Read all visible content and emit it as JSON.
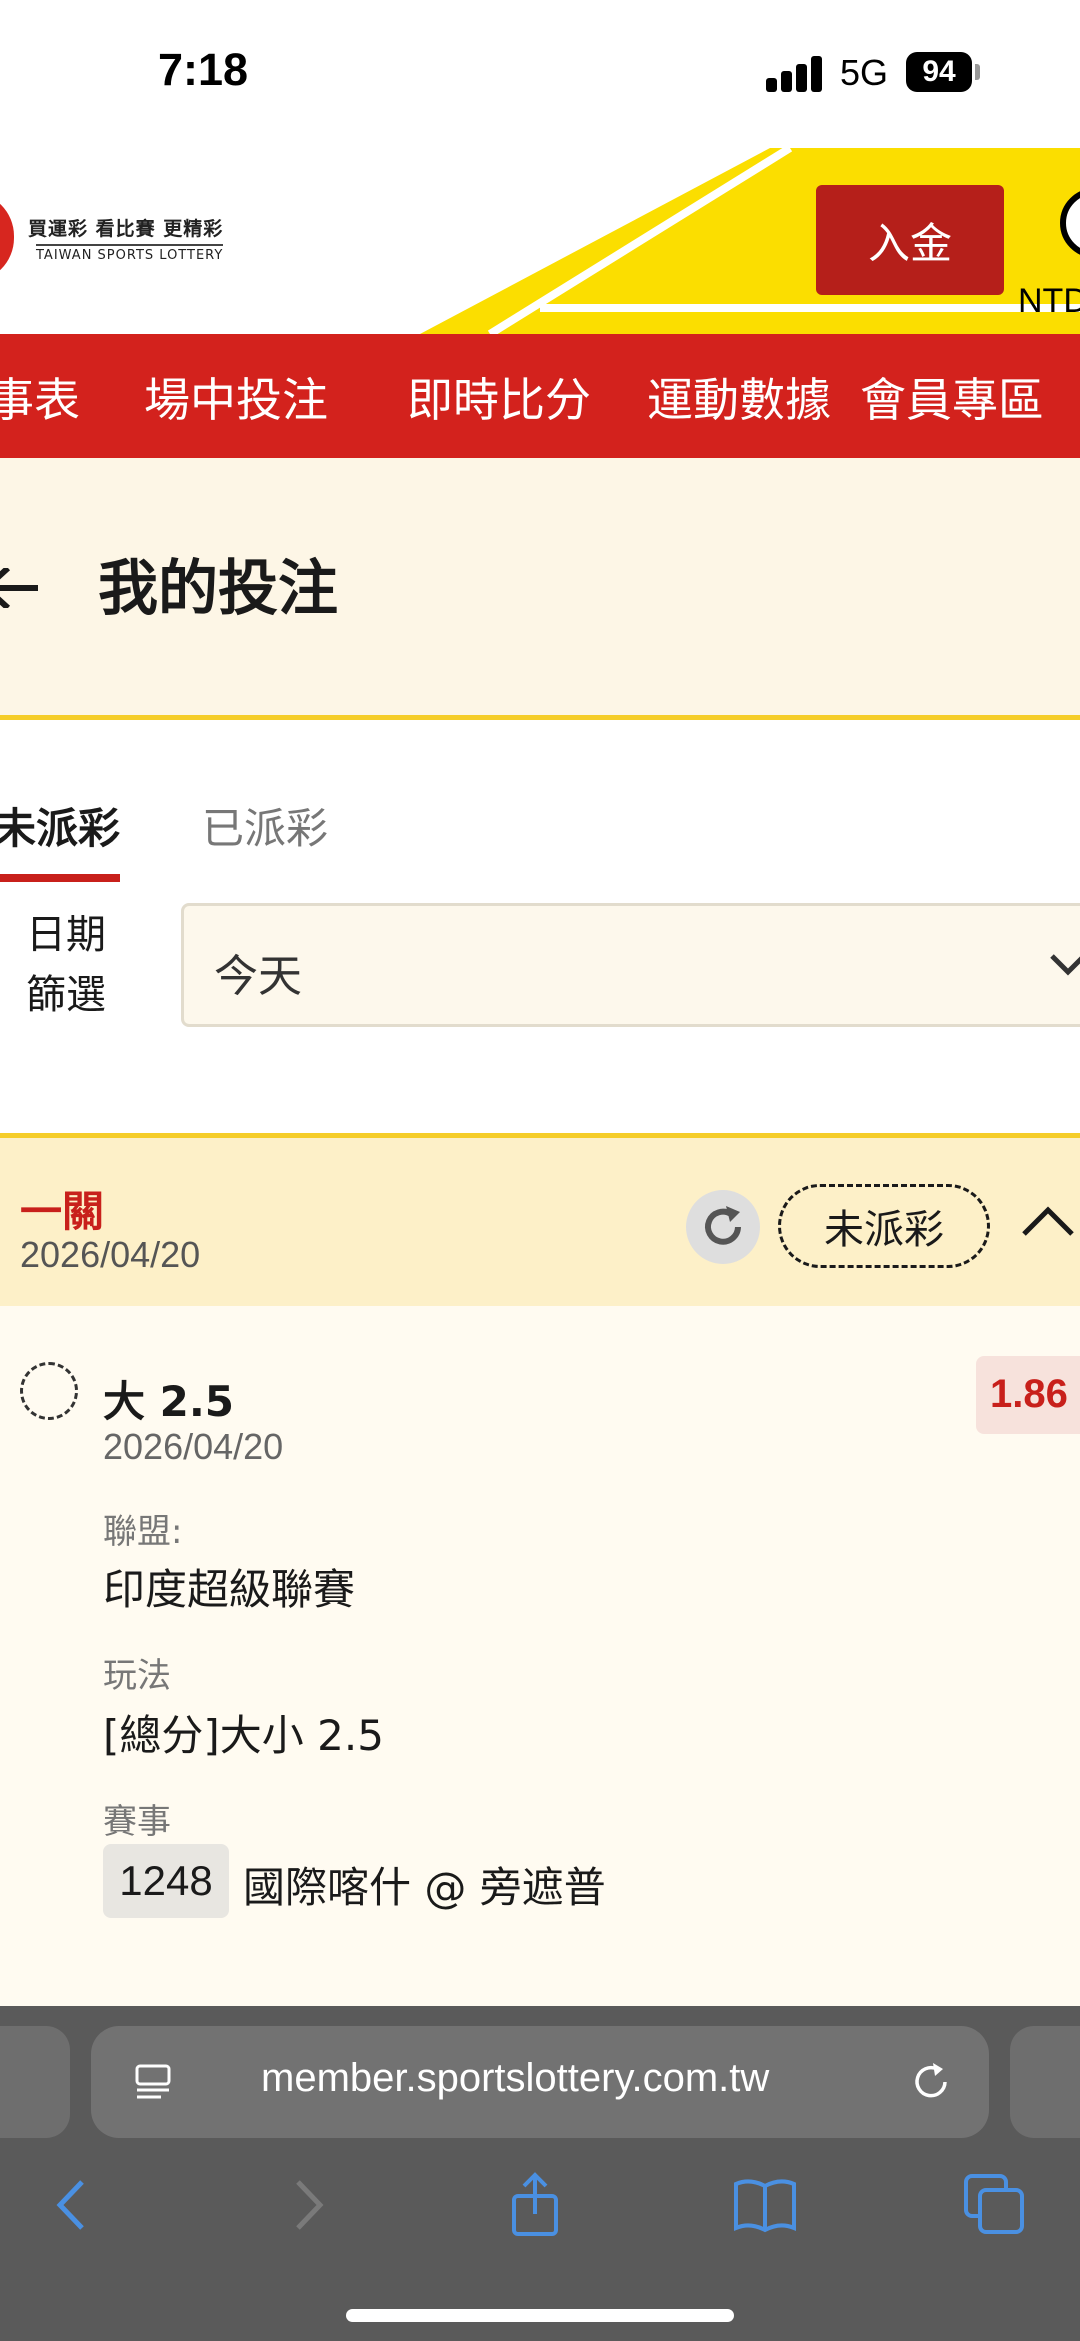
{
  "status_bar": {
    "time": "7:18",
    "network": "5G",
    "battery": "94"
  },
  "header": {
    "logo_line1": "買運彩 看比賽 更精彩",
    "logo_line2": "TAIWAN SPORTS LOTTERY",
    "deposit_label": "入金",
    "currency_label": "NTD"
  },
  "nav": {
    "items": [
      "事表",
      "場中投注",
      "即時比分",
      "運動數據",
      "會員專區"
    ]
  },
  "page": {
    "title": "我的投注"
  },
  "tabs": {
    "active": "未派彩",
    "inactive": "已派彩"
  },
  "filter": {
    "label_line1": "日期",
    "label_line2": "篩選",
    "value": "今天"
  },
  "bet": {
    "type": "一關",
    "date": "2026/04/20",
    "status": "未派彩",
    "selection": "大 2.5",
    "odds": "1.86",
    "selection_date": "2026/04/20",
    "league_label": "聯盟:",
    "league_value": "印度超級聯賽",
    "play_label": "玩法",
    "play_value": "[總分]大小 2.5",
    "event_label": "賽事",
    "event_code": "1248",
    "event_teams": "國際喀什 @ 旁遮普"
  },
  "browser": {
    "url": "member.sportslottery.com.tw"
  },
  "colors": {
    "brand_red": "#d3221d",
    "accent_yellow": "#f5cd29",
    "odds_red": "#c8201b"
  },
  "icons": [
    "back-arrow-icon",
    "chevron-down-icon",
    "refresh-icon",
    "chevron-up-icon",
    "reader-icon",
    "reload-icon",
    "back-icon",
    "forward-icon",
    "share-icon",
    "bookmarks-icon",
    "tabs-icon"
  ]
}
